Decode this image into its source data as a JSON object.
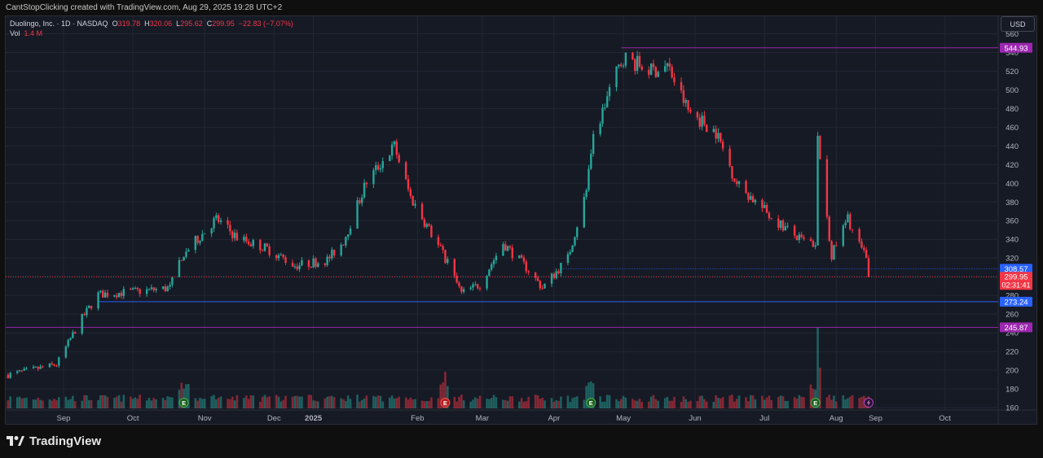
{
  "header": {
    "caption": "CantStopClicking created with TradingView.com, Aug 29, 2025 19:28 UTC+2"
  },
  "legend": {
    "symbol": "Duolingo, Inc. · 1D · NASDAQ",
    "open_label": "O",
    "open": "319.78",
    "high_label": "H",
    "high": "320.06",
    "low_label": "L",
    "low": "295.62",
    "close_label": "C",
    "close": "299.95",
    "change": "−22.83 (−7.07%)",
    "vol_label": "Vol",
    "vol": "1.4 M"
  },
  "currency": "USD",
  "brand": {
    "name": "TradingView",
    "icon": "tradingview-logo-icon"
  },
  "colors": {
    "up": "#26a69a",
    "down": "#f23645",
    "purple_line": "#9c27b0",
    "blue_line": "#2962ff"
  },
  "chart_data": {
    "type": "candlestick",
    "title": "Duolingo, Inc. · 1D · NASDAQ",
    "ylim": [
      160,
      570
    ],
    "y_ticks": [
      160,
      180,
      200,
      220,
      240,
      260,
      280,
      300,
      320,
      340,
      360,
      380,
      400,
      420,
      440,
      460,
      480,
      500,
      520,
      540,
      560
    ],
    "x_ticks": [
      "Sep",
      "Oct",
      "Nov",
      "Dec",
      "2025",
      "Feb",
      "Mar",
      "Apr",
      "May",
      "Jun",
      "Jul",
      "Aug",
      "Sep",
      "Oct"
    ],
    "price_path": [
      {
        "date": "2024-08-22",
        "price": 195
      },
      {
        "date": "2024-09-12",
        "price": 206
      },
      {
        "date": "2024-09-22",
        "price": 252
      },
      {
        "date": "2024-09-30",
        "price": 281
      },
      {
        "date": "2024-10-20",
        "price": 285
      },
      {
        "date": "2024-10-31",
        "price": 288
      },
      {
        "date": "2024-11-05",
        "price": 322
      },
      {
        "date": "2024-11-20",
        "price": 362
      },
      {
        "date": "2024-11-29",
        "price": 342
      },
      {
        "date": "2024-12-12",
        "price": 330
      },
      {
        "date": "2024-12-24",
        "price": 312
      },
      {
        "date": "2025-01-07",
        "price": 318
      },
      {
        "date": "2025-01-14",
        "price": 338
      },
      {
        "date": "2025-01-24",
        "price": 402
      },
      {
        "date": "2025-02-05",
        "price": 440
      },
      {
        "date": "2025-02-12",
        "price": 385
      },
      {
        "date": "2025-02-27",
        "price": 320
      },
      {
        "date": "2025-03-06",
        "price": 282
      },
      {
        "date": "2025-03-14",
        "price": 292
      },
      {
        "date": "2025-03-24",
        "price": 336
      },
      {
        "date": "2025-04-03",
        "price": 310
      },
      {
        "date": "2025-04-10",
        "price": 288
      },
      {
        "date": "2025-04-21",
        "price": 320
      },
      {
        "date": "2025-04-29",
        "price": 392
      },
      {
        "date": "2025-05-02",
        "price": 446
      },
      {
        "date": "2025-05-09",
        "price": 500
      },
      {
        "date": "2025-05-15",
        "price": 535
      },
      {
        "date": "2025-05-27",
        "price": 520
      },
      {
        "date": "2025-06-03",
        "price": 526
      },
      {
        "date": "2025-06-12",
        "price": 478
      },
      {
        "date": "2025-06-24",
        "price": 455
      },
      {
        "date": "2025-07-03",
        "price": 400
      },
      {
        "date": "2025-07-17",
        "price": 366
      },
      {
        "date": "2025-07-31",
        "price": 338
      },
      {
        "date": "2025-08-06",
        "price": 335
      },
      {
        "date": "2025-08-07",
        "price": 448
      },
      {
        "date": "2025-08-13",
        "price": 323
      },
      {
        "date": "2025-08-20",
        "price": 362
      },
      {
        "date": "2025-08-28",
        "price": 318
      },
      {
        "date": "2025-08-29",
        "price": 299.95
      }
    ],
    "volume_spikes": [
      {
        "date": "2025-02-27",
        "rel": 0.45
      },
      {
        "date": "2025-05-01",
        "rel": 0.33
      },
      {
        "date": "2025-08-07",
        "rel": 1.0
      },
      {
        "date": "2025-08-08",
        "rel": 0.5
      }
    ],
    "horizontal_lines": [
      {
        "label": "544.93",
        "value": 544.93,
        "color": "#9c27b0",
        "start_date": "2025-05-14"
      },
      {
        "label": "308.57",
        "value": 308.57,
        "color": "#2962ff",
        "style": "dotted",
        "start_date": "2025-04-18"
      },
      {
        "label": "273.24",
        "value": 273.24,
        "color": "#2962ff",
        "start_date": "2024-09-30"
      },
      {
        "label": "245.87",
        "value": 245.87,
        "color": "#9c27b0"
      },
      {
        "value": 299.95,
        "color": "#f23645",
        "style": "dotted"
      }
    ],
    "last_price": {
      "label": "299.95",
      "timer": "02:31:41",
      "value": 299.95
    },
    "earnings_markers": [
      "2024-11-06",
      "2025-02-27",
      "2025-05-01",
      "2025-08-06"
    ],
    "upcoming_event_marker": "2025-08-29",
    "x_domain": [
      "2024-08-21",
      "2025-10-24"
    ]
  }
}
